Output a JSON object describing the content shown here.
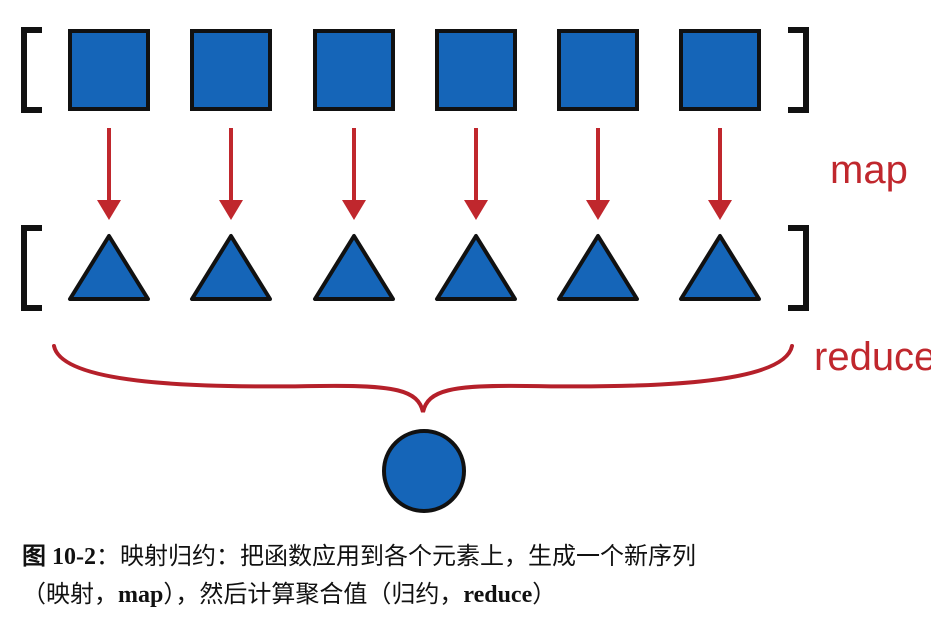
{
  "labels": {
    "map": "map",
    "reduce": "reduce"
  },
  "input_items": [
    "square",
    "square",
    "square",
    "square",
    "square",
    "square"
  ],
  "mapped_items": [
    "triangle",
    "triangle",
    "triangle",
    "triangle",
    "triangle",
    "triangle"
  ],
  "result_item": "circle",
  "colors": {
    "shape_fill": "#1565b8",
    "shape_stroke": "#111111",
    "arrow": "#c0272d",
    "label": "#c0272d",
    "bracket": "#111111"
  },
  "caption": {
    "fig_num": "图 10-2",
    "line1_rest": "：映射归约：把函数应用到各个元素上，生成一个新序列",
    "line2_pre": "（映射，",
    "map_word": "map",
    "line2_mid": "），然后计算聚合值（归约，",
    "reduce_word": "reduce",
    "line2_end": "）"
  }
}
